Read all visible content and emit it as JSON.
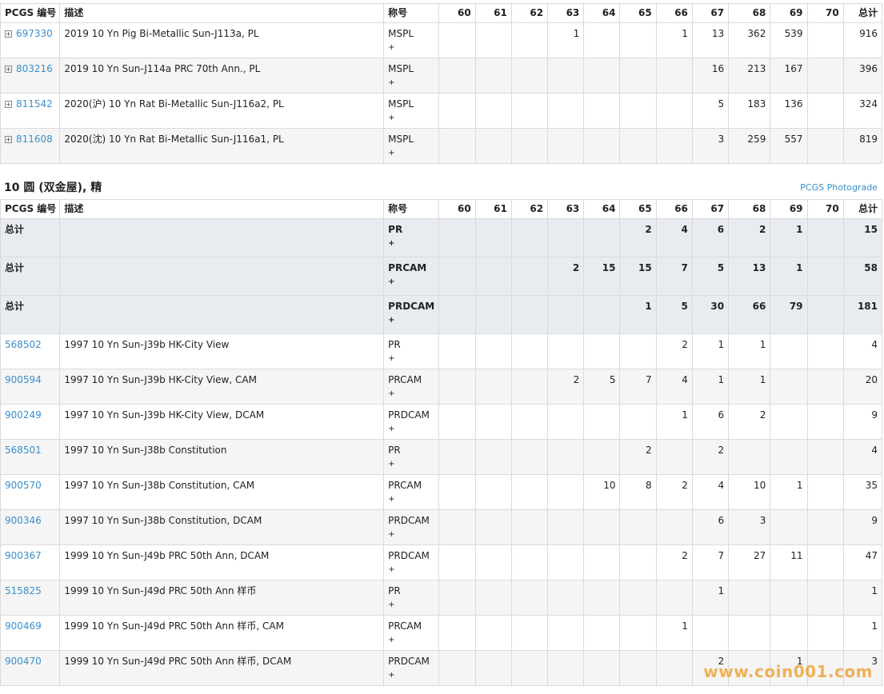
{
  "headers": [
    "PCGS 编号",
    "描述",
    "称号",
    "60",
    "61",
    "62",
    "63",
    "64",
    "65",
    "66",
    "67",
    "68",
    "69",
    "70",
    "总计"
  ],
  "table1": {
    "rows": [
      {
        "code": "697330",
        "desc": "2019 10 Yn Pig Bi-Metallic Sun-J113a, PL",
        "des": "MSPL",
        "plus": "+",
        "g": [
          "",
          "",
          "",
          "1",
          "",
          "",
          "1",
          "13",
          "362",
          "539",
          "",
          "916"
        ]
      },
      {
        "code": "803216",
        "desc": "2019 10 Yn Sun-J114a PRC 70th Ann., PL",
        "des": "MSPL",
        "plus": "+",
        "g": [
          "",
          "",
          "",
          "",
          "",
          "",
          "",
          "16",
          "213",
          "167",
          "",
          "396"
        ]
      },
      {
        "code": "811542",
        "desc": "2020(沪) 10 Yn Rat Bi-Metallic Sun-J116a2, PL",
        "des": "MSPL",
        "plus": "+",
        "g": [
          "",
          "",
          "",
          "",
          "",
          "",
          "",
          "5",
          "183",
          "136",
          "",
          "324"
        ]
      },
      {
        "code": "811608",
        "desc": "2020(沈) 10 Yn Rat Bi-Metallic Sun-J116a1, PL",
        "des": "MSPL",
        "plus": "+",
        "g": [
          "",
          "",
          "",
          "",
          "",
          "",
          "",
          "3",
          "259",
          "557",
          "",
          "819"
        ]
      }
    ]
  },
  "section2": {
    "title": "10 圆 (双金屋), 精",
    "photograde_link": "PCGS Photograde"
  },
  "table2": {
    "totals": [
      {
        "label": "总计",
        "des": "PR",
        "plus": "+",
        "g": [
          "",
          "",
          "",
          "",
          "",
          "2",
          "4",
          "6",
          "2",
          "1",
          "",
          "15"
        ]
      },
      {
        "label": "总计",
        "des": "PRCAM",
        "plus": "+",
        "g": [
          "",
          "",
          "",
          "2",
          "15",
          "15",
          "7",
          "5",
          "13",
          "1",
          "",
          "58"
        ]
      },
      {
        "label": "总计",
        "des": "PRDCAM",
        "plus": "+",
        "g": [
          "",
          "",
          "",
          "",
          "",
          "1",
          "5",
          "30",
          "66",
          "79",
          "",
          "181"
        ]
      }
    ],
    "rows": [
      {
        "code": "568502",
        "desc": "1997 10 Yn Sun-J39b HK-City View",
        "des": "PR",
        "plus": "+",
        "g": [
          "",
          "",
          "",
          "",
          "",
          "",
          "2",
          "1",
          "1",
          "",
          "",
          "4"
        ]
      },
      {
        "code": "900594",
        "desc": "1997 10 Yn Sun-J39b HK-City View, CAM",
        "des": "PRCAM",
        "plus": "+",
        "g": [
          "",
          "",
          "",
          "2",
          "5",
          "7",
          "4",
          "1",
          "1",
          "",
          "",
          "20"
        ]
      },
      {
        "code": "900249",
        "desc": "1997 10 Yn Sun-J39b HK-City View, DCAM",
        "des": "PRDCAM",
        "plus": "+",
        "g": [
          "",
          "",
          "",
          "",
          "",
          "",
          "1",
          "6",
          "2",
          "",
          "",
          "9"
        ]
      },
      {
        "code": "568501",
        "desc": "1997 10 Yn Sun-J38b Constitution",
        "des": "PR",
        "plus": "+",
        "g": [
          "",
          "",
          "",
          "",
          "",
          "2",
          "",
          "2",
          "",
          "",
          "",
          "4"
        ]
      },
      {
        "code": "900570",
        "desc": "1997 10 Yn Sun-J38b Constitution, CAM",
        "des": "PRCAM",
        "plus": "+",
        "g": [
          "",
          "",
          "",
          "",
          "10",
          "8",
          "2",
          "4",
          "10",
          "1",
          "",
          "35"
        ]
      },
      {
        "code": "900346",
        "desc": "1997 10 Yn Sun-J38b Constitution, DCAM",
        "des": "PRDCAM",
        "plus": "+",
        "g": [
          "",
          "",
          "",
          "",
          "",
          "",
          "",
          "6",
          "3",
          "",
          "",
          "9"
        ]
      },
      {
        "code": "900367",
        "desc": "1999 10 Yn Sun-J49b PRC 50th Ann, DCAM",
        "des": "PRDCAM",
        "plus": "+",
        "g": [
          "",
          "",
          "",
          "",
          "",
          "",
          "2",
          "7",
          "27",
          "11",
          "",
          "47"
        ]
      },
      {
        "code": "515825",
        "desc": "1999 10 Yn Sun-J49d PRC 50th Ann 样币",
        "des": "PR",
        "plus": "+",
        "g": [
          "",
          "",
          "",
          "",
          "",
          "",
          "",
          "1",
          "",
          "",
          "",
          "1"
        ]
      },
      {
        "code": "900469",
        "desc": "1999 10 Yn Sun-J49d PRC 50th Ann 样币, CAM",
        "des": "PRCAM",
        "plus": "+",
        "g": [
          "",
          "",
          "",
          "",
          "",
          "",
          "1",
          "",
          "",
          "",
          "",
          "1"
        ]
      },
      {
        "code": "900470",
        "desc": "1999 10 Yn Sun-J49d PRC 50th Ann 样币, DCAM",
        "des": "PRDCAM",
        "plus": "+",
        "g": [
          "",
          "",
          "",
          "",
          "",
          "",
          "",
          "2",
          "",
          "1",
          "",
          "3"
        ]
      }
    ]
  },
  "watermark": "www.coin001.com"
}
